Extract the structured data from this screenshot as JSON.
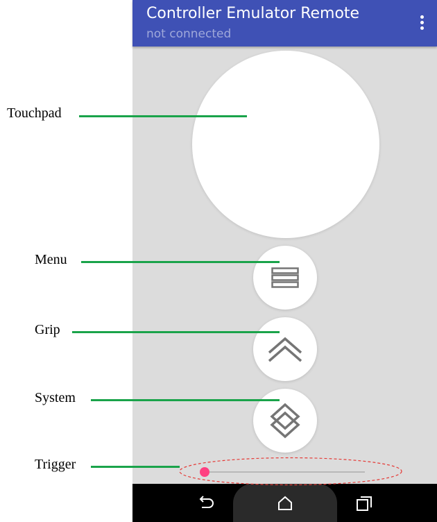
{
  "app": {
    "title": "Controller Emulator Remote",
    "subtitle": "not connected",
    "colors": {
      "appbar": "#3f51b5",
      "subtitle": "#9fa8da",
      "accent": "#ff4081",
      "background": "#dcdcdc"
    }
  },
  "controls": {
    "touchpad": {
      "name": "touchpad"
    },
    "menu_button": {
      "icon": "menu-icon"
    },
    "grip_button": {
      "icon": "chevron-up-icon"
    },
    "system_button": {
      "icon": "layers-icon"
    },
    "trigger_slider": {
      "value": 0.0
    }
  },
  "annotations": {
    "touchpad": "Touchpad",
    "menu": "Menu",
    "grip": "Grip",
    "system": "System",
    "trigger": "Trigger",
    "line_color": "#1aa34a",
    "highlight_color": "#e53935"
  },
  "navbar": {
    "back_icon": "back-icon",
    "home_icon": "home-icon",
    "recents_icon": "recents-icon"
  }
}
